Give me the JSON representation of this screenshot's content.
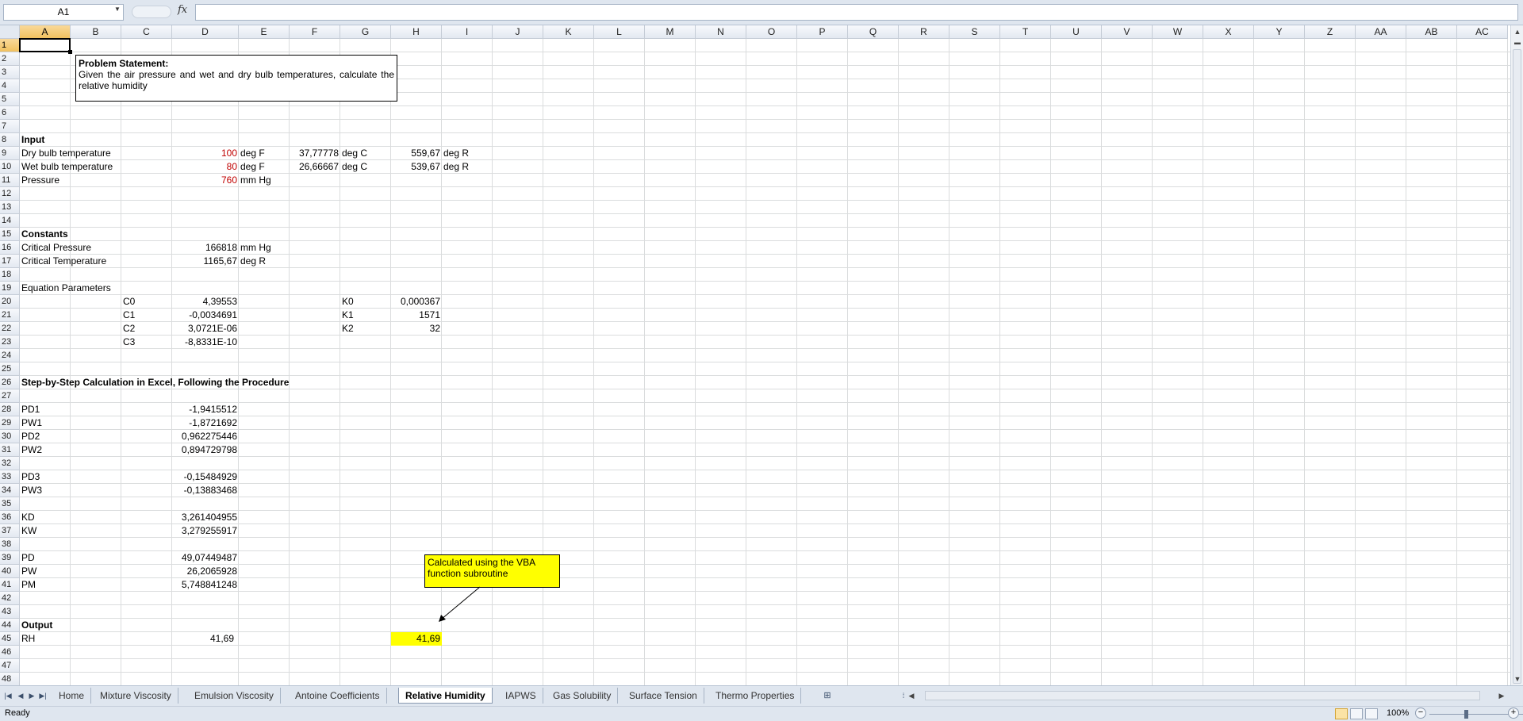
{
  "formula_bar": {
    "name_box": "A1",
    "fx_icon": "fx-icon",
    "formula": ""
  },
  "columns": [
    "A",
    "B",
    "C",
    "D",
    "E",
    "F",
    "G",
    "H",
    "I",
    "J",
    "K",
    "L",
    "M",
    "N",
    "O",
    "P",
    "Q",
    "R",
    "S",
    "T",
    "U",
    "V",
    "W",
    "X",
    "Y",
    "Z",
    "AA",
    "AB",
    "AC"
  ],
  "rows": [
    "1",
    "2",
    "3",
    "4",
    "5",
    "6",
    "7",
    "8",
    "9",
    "10",
    "11",
    "12",
    "13",
    "14",
    "15",
    "16",
    "17",
    "18",
    "19",
    "20",
    "21",
    "22",
    "23",
    "24",
    "25",
    "26",
    "27",
    "28",
    "29",
    "30",
    "31",
    "32",
    "33",
    "34",
    "35",
    "36",
    "37",
    "38",
    "39",
    "40",
    "41",
    "42",
    "43",
    "44",
    "45",
    "46",
    "47",
    "48"
  ],
  "problem": {
    "title": "Problem Statement:",
    "body": "Given the air pressure and wet and dry bulb temperatures, calculate the relative humidity"
  },
  "cells": {
    "A8": "Input",
    "A9": "Dry bulb temperature",
    "D9": "100",
    "E9": "deg F",
    "F9": "37,77778",
    "G9": "deg C",
    "H9": "559,67",
    "I9": "deg R",
    "A10": "Wet bulb temperature",
    "D10": "80",
    "E10": "deg F",
    "F10": "26,66667",
    "G10": "deg C",
    "H10": "539,67",
    "I10": "deg R",
    "A11": "Pressure",
    "D11": "760",
    "E11": "mm Hg",
    "A15": "Constants",
    "A16": "Critical Pressure",
    "D16": "166818",
    "E16": "mm Hg",
    "A17": "Critical Temperature",
    "D17": "1165,67",
    "E17": "deg R",
    "A19": "Equation Parameters",
    "C20": "C0",
    "D20": "4,39553",
    "G20": "K0",
    "H20": "0,000367",
    "C21": "C1",
    "D21": "-0,0034691",
    "G21": "K1",
    "H21": "1571",
    "C22": "C2",
    "D22": "3,0721E-06",
    "G22": "K2",
    "H22": "32",
    "C23": "C3",
    "D23": "-8,8331E-10",
    "A26": "Step-by-Step Calculation in Excel, Following the Procedure",
    "A28": "PD1",
    "D28": "-1,9415512",
    "A29": "PW1",
    "D29": "-1,8721692",
    "A30": "PD2",
    "D30": "0,962275446",
    "A31": "PW2",
    "D31": "0,894729798",
    "A33": "PD3",
    "D33": "-0,15484929",
    "A34": "PW3",
    "D34": "-0,13883468",
    "A36": "KD",
    "D36": "3,261404955",
    "A37": "KW",
    "D37": "3,279255917",
    "A39": "PD",
    "D39": "49,07449487",
    "A40": "PW",
    "D40": "26,2065928",
    "A41": "PM",
    "D41": "5,748841248",
    "A44": "Output",
    "A45": "RH",
    "D45": "41,69",
    "H45": "41,69"
  },
  "note": {
    "text": "Calculated using the VBA function subroutine"
  },
  "sheets": {
    "tabs": [
      "Home",
      "Mixture Viscosity",
      "Emulsion Viscosity",
      "Antoine Coefficients",
      "Relative Humidity",
      "IAPWS",
      "Gas Solubility",
      "Surface Tension",
      "Thermo Properties"
    ],
    "active": "Relative Humidity",
    "insert_icon": "insert-sheet-icon"
  },
  "status": {
    "text": "Ready",
    "zoom": "100%"
  },
  "colors": {
    "input_red": "#c00000",
    "highlight": "#ffff00",
    "accent": "#f1c15f"
  }
}
